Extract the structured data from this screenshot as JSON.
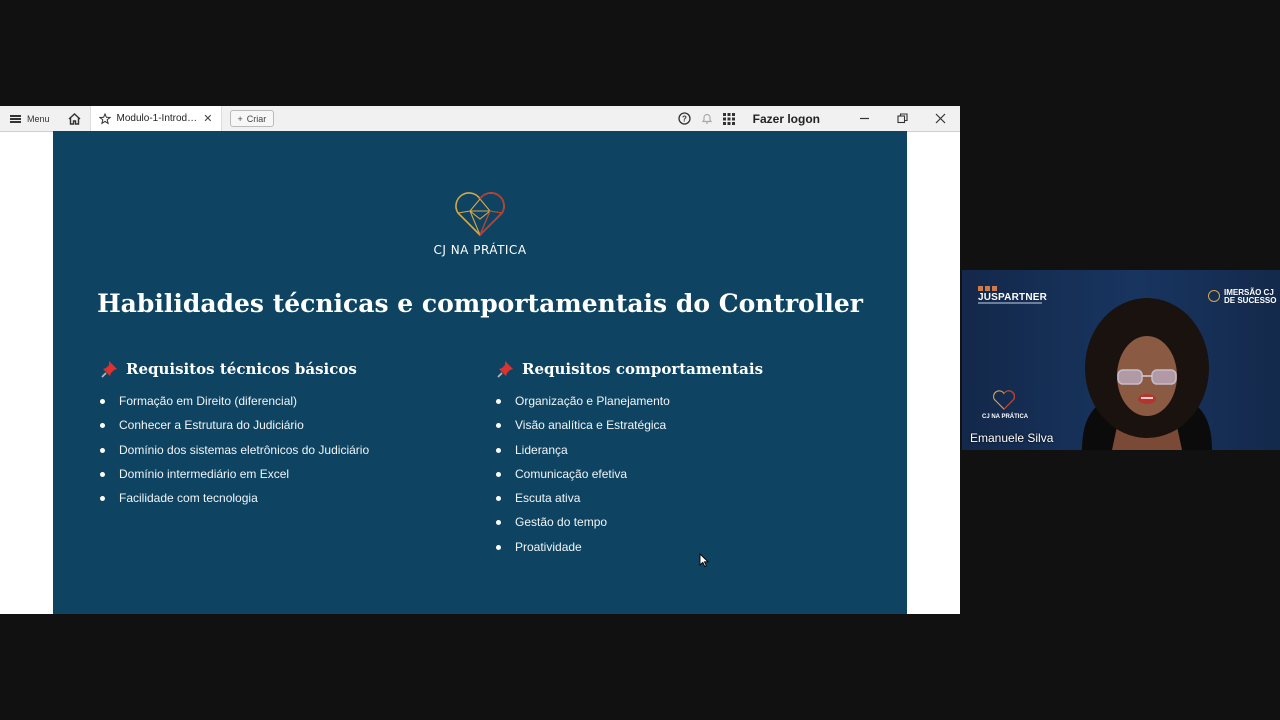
{
  "toolbar": {
    "menu_label": "Menu",
    "tab_label": "Modulo-1-Introduca...",
    "new_label": "Criar",
    "logon_label": "Fazer logon"
  },
  "slide": {
    "brand": "CJ NA PRÁTICA",
    "title": "Habilidades técnicas e comportamentais do Controller",
    "left": {
      "heading": "Requisitos técnicos básicos",
      "items": [
        "Formação em Direito (diferencial)",
        "Conhecer a Estrutura do Judiciário",
        "Domínio dos sistemas eletrônicos do Judiciário",
        "Domínio intermediário em Excel",
        "Facilidade com tecnologia"
      ]
    },
    "right": {
      "heading": "Requisitos comportamentais",
      "items": [
        "Organização e Planejamento",
        "Visão analítica e Estratégica",
        "Liderança",
        "Comunicação efetiva",
        "Escuta ativa",
        "Gestão do tempo",
        "Proatividade"
      ]
    }
  },
  "camera": {
    "brand_left": "JUSPARTNER",
    "brand_right": "IMERSÃO CJ DE SUCESSO",
    "brand_bottom": "CJ NA PRÁTICA",
    "participant_name": "Emanuele Silva"
  },
  "colors": {
    "slide_bg": "#0e4462",
    "accent_gold": "#d6a64a",
    "accent_red": "#c0392b"
  }
}
